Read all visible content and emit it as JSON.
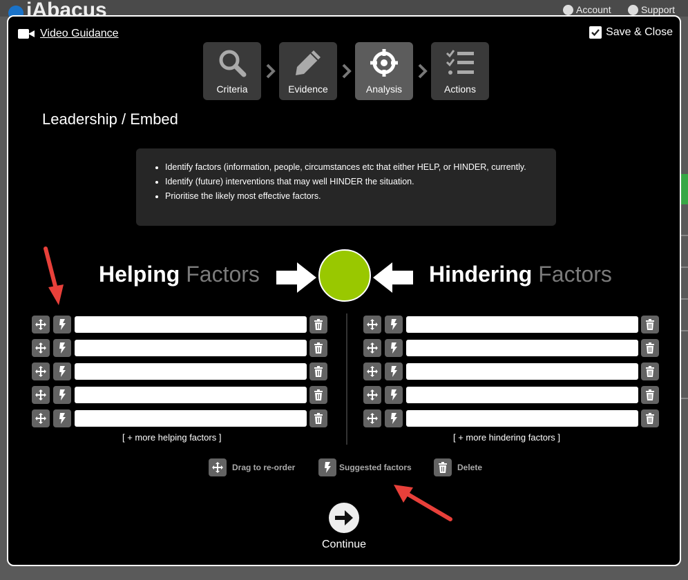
{
  "app": {
    "logo": "iAbacus",
    "account_label": "Account",
    "support_label": "Support"
  },
  "modal": {
    "video_guidance_label": "Video Guidance",
    "save_close_label": "Save & Close",
    "steps": [
      {
        "label": "Criteria",
        "icon": "search-icon",
        "active": false
      },
      {
        "label": "Evidence",
        "icon": "pencil-icon",
        "active": false
      },
      {
        "label": "Analysis",
        "icon": "crosshair-icon",
        "active": true
      },
      {
        "label": "Actions",
        "icon": "checklist-icon",
        "active": false
      }
    ],
    "section_title": "Leadership / Embed",
    "instructions": [
      "Identify factors (information, people, circumstances etc that either HELP, or HINDER, currently.",
      "Identify (future) interventions that may well HINDER the situation.",
      "Prioritise the likely most effective factors."
    ],
    "helping": {
      "heading_bold": "Helping",
      "heading_dim": "Factors",
      "rows": [
        "",
        "",
        "",
        "",
        ""
      ],
      "more_label": "[ + more helping factors ]"
    },
    "hindering": {
      "heading_bold": "Hindering",
      "heading_dim": "Factors",
      "rows": [
        "",
        "",
        "",
        "",
        ""
      ],
      "more_label": "[ + more hindering factors ]"
    },
    "legend": {
      "drag_label": "Drag to re-order",
      "suggested_label": "Suggested factors",
      "delete_label": "Delete"
    },
    "continue_label": "Continue"
  },
  "colors": {
    "accent_green": "#99c800",
    "modal_bg": "#000000",
    "button_gray": "#636363",
    "annotation_red": "#e8403a"
  }
}
